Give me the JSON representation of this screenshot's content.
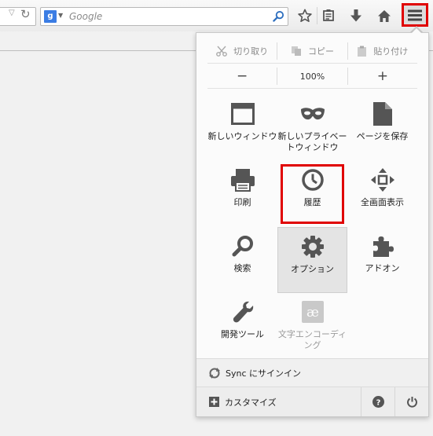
{
  "toolbar": {
    "search_placeholder": "Google",
    "engine_letter": "g",
    "icons": [
      "dropdown-icon",
      "reload-icon",
      "search-engine-icon",
      "search-go-icon",
      "bookmark-star-icon",
      "reading-list-icon",
      "download-icon",
      "home-icon",
      "menu-icon"
    ]
  },
  "panel": {
    "edit": {
      "cut": "切り取り",
      "copy": "コピー",
      "paste": "貼り付け"
    },
    "zoom": {
      "minus": "−",
      "level": "100%",
      "plus": "+"
    },
    "items": [
      {
        "id": "new-window",
        "label": "新しいウィンドウ",
        "icon": "window-icon"
      },
      {
        "id": "private-window",
        "label": "新しいプライベー\nトウィンドウ",
        "icon": "mask-icon"
      },
      {
        "id": "save-page",
        "label": "ページを保存",
        "icon": "page-icon"
      },
      {
        "id": "print",
        "label": "印刷",
        "icon": "printer-icon"
      },
      {
        "id": "history",
        "label": "履歴",
        "icon": "clock-icon"
      },
      {
        "id": "fullscreen",
        "label": "全画面表示",
        "icon": "fullscreen-arrows-icon"
      },
      {
        "id": "find",
        "label": "検索",
        "icon": "magnifier-icon"
      },
      {
        "id": "options",
        "label": "オプション",
        "icon": "gear-icon"
      },
      {
        "id": "addons",
        "label": "アドオン",
        "icon": "puzzle-icon"
      },
      {
        "id": "developer",
        "label": "開発ツール",
        "icon": "wrench-icon"
      },
      {
        "id": "encoding",
        "label": "文字エンコーディ\nング",
        "icon": "encoding-icon"
      }
    ],
    "sync_label": "Sync にサインイン",
    "customize_label": "カスタマイズ"
  },
  "colors": {
    "highlight": "#e00000",
    "icon": "#555555",
    "search_badge": "#3b7de4"
  }
}
